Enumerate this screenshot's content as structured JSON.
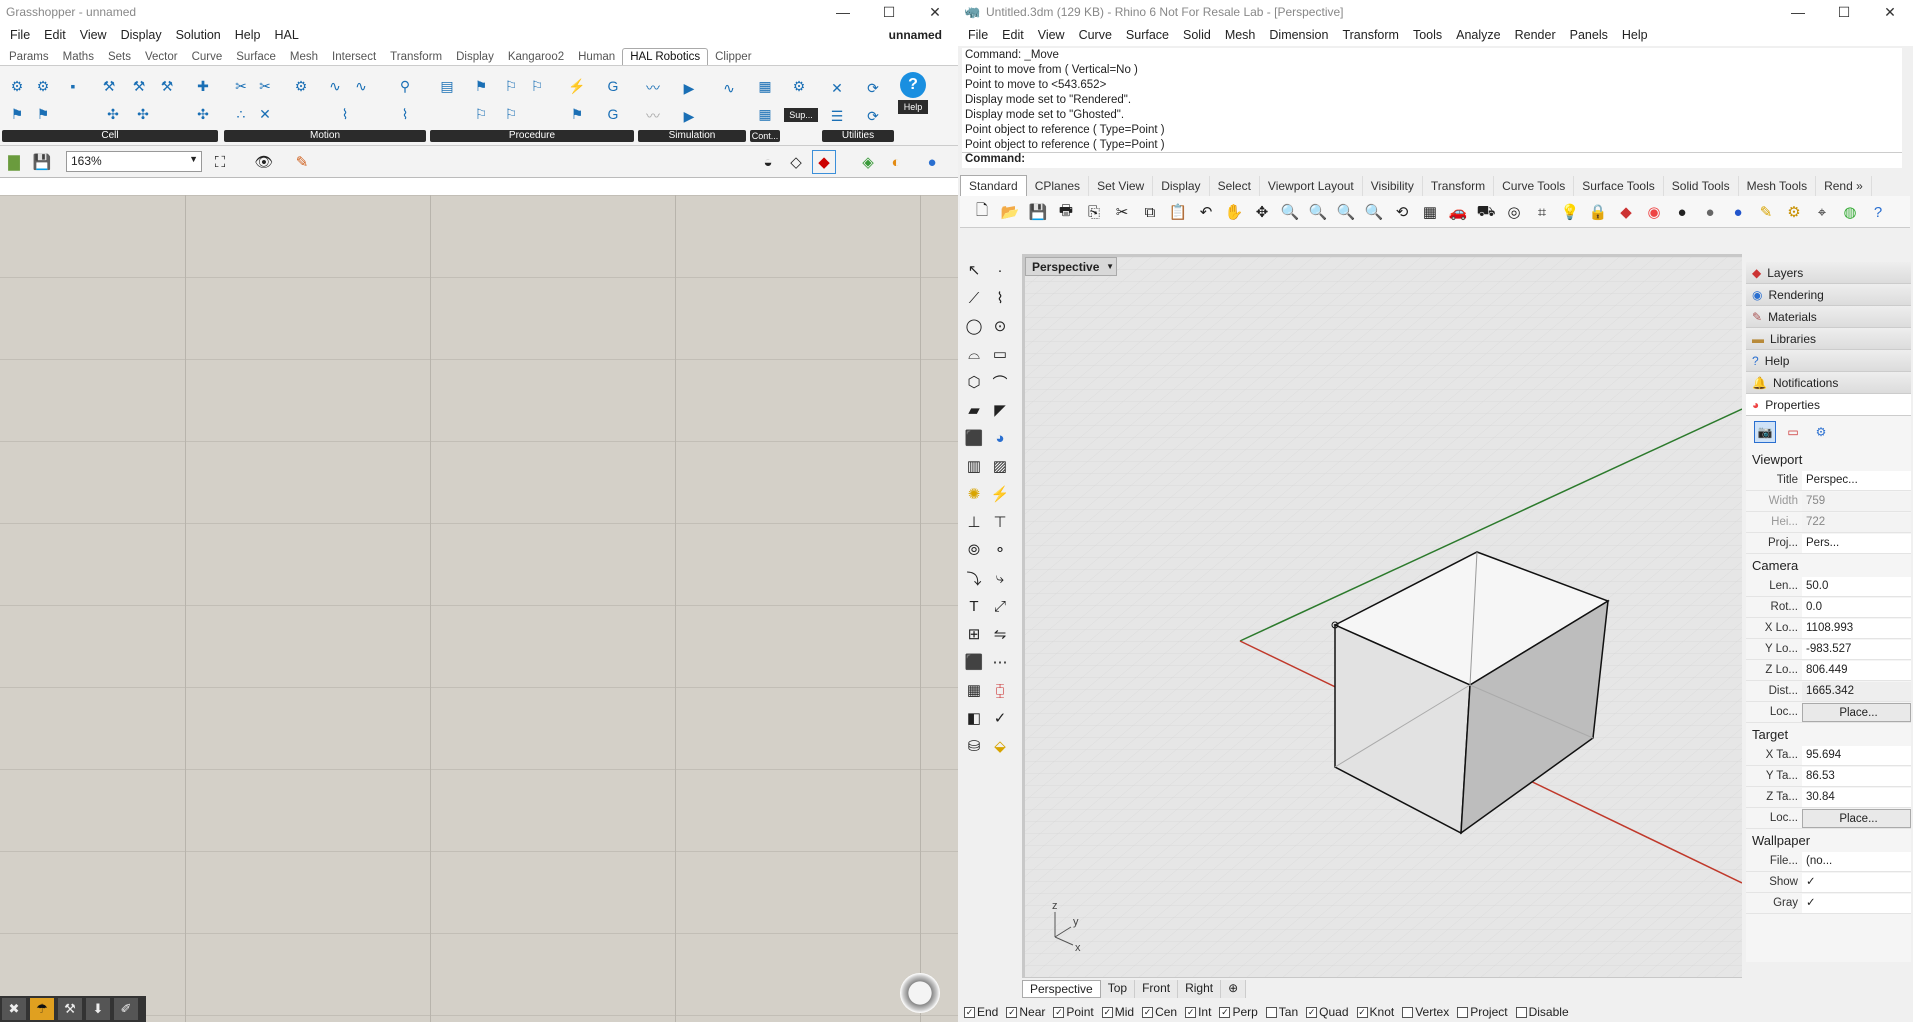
{
  "gh": {
    "title": "Grasshopper - unnamed",
    "doc_name": "unnamed",
    "menu": [
      "File",
      "Edit",
      "View",
      "Display",
      "Solution",
      "Help",
      "HAL"
    ],
    "tabs": [
      "Params",
      "Maths",
      "Sets",
      "Vector",
      "Curve",
      "Surface",
      "Mesh",
      "Intersect",
      "Transform",
      "Display",
      "Kangaroo2",
      "Human",
      "HAL Robotics",
      "Clipper"
    ],
    "active_tab": "HAL Robotics",
    "groups": [
      "Cell",
      "Motion",
      "Procedure",
      "Simulation",
      "Cont...",
      "Utilities"
    ],
    "sup_label": "Sup...",
    "help_label": "Help",
    "zoom": "163%",
    "canvas_color": "#d4d0c8"
  },
  "rhino": {
    "title": "Untitled.3dm (129 KB) - Rhino 6 Not For Resale Lab - [Perspective]",
    "menu": [
      "File",
      "Edit",
      "View",
      "Curve",
      "Surface",
      "Solid",
      "Mesh",
      "Dimension",
      "Transform",
      "Tools",
      "Analyze",
      "Render",
      "Panels",
      "Help"
    ],
    "command_history": [
      "Command: _Move",
      "Point to move from ( Vertical=No )",
      "Point to move to <543.652>",
      "Display mode set to \"Rendered\".",
      "Display mode set to \"Ghosted\".",
      "Point object to reference ( Type=Point )",
      "Point object to reference ( Type=Point )"
    ],
    "command_prompt": "Command:",
    "toolbar_tabs": [
      "Standard",
      "CPlanes",
      "Set View",
      "Display",
      "Select",
      "Viewport Layout",
      "Visibility",
      "Transform",
      "Curve Tools",
      "Surface Tools",
      "Solid Tools",
      "Mesh Tools",
      "Rend »"
    ],
    "active_toolbar_tab": "Standard",
    "viewport_name": "Perspective",
    "viewport_tabs": [
      "Perspective",
      "Top",
      "Front",
      "Right"
    ],
    "active_viewport_tab": "Perspective",
    "axis_labels": {
      "z": "z",
      "y": "y",
      "x": "x"
    },
    "osnaps": [
      {
        "label": "End",
        "checked": true
      },
      {
        "label": "Near",
        "checked": true
      },
      {
        "label": "Point",
        "checked": true
      },
      {
        "label": "Mid",
        "checked": true
      },
      {
        "label": "Cen",
        "checked": true
      },
      {
        "label": "Int",
        "checked": true
      },
      {
        "label": "Perp",
        "checked": true
      },
      {
        "label": "Tan",
        "checked": false
      },
      {
        "label": "Quad",
        "checked": true
      },
      {
        "label": "Knot",
        "checked": true
      },
      {
        "label": "Vertex",
        "checked": false
      },
      {
        "label": "Project",
        "checked": false
      },
      {
        "label": "Disable",
        "checked": false
      }
    ],
    "panel_tabs": [
      "Layers",
      "Rendering",
      "Materials",
      "Libraries",
      "Help",
      "Notifications",
      "Properties"
    ],
    "properties": {
      "viewport_header": "Viewport",
      "viewport_rows": [
        {
          "key": "Title",
          "value": "Perspec...",
          "disabled": false
        },
        {
          "key": "Width",
          "value": "759",
          "disabled": true
        },
        {
          "key": "Hei...",
          "value": "722",
          "disabled": true
        },
        {
          "key": "Proj...",
          "value": "Pers...",
          "disabled": false
        }
      ],
      "camera_header": "Camera",
      "camera_rows": [
        {
          "key": "Len...",
          "value": "50.0"
        },
        {
          "key": "Rot...",
          "value": "0.0"
        },
        {
          "key": "X Lo...",
          "value": "1108.993"
        },
        {
          "key": "Y Lo...",
          "value": "-983.527"
        },
        {
          "key": "Z Lo...",
          "value": "806.449"
        },
        {
          "key": "Dist...",
          "value": "1665.342"
        },
        {
          "key": "Loc...",
          "value": "Place..."
        }
      ],
      "target_header": "Target",
      "target_rows": [
        {
          "key": "X Ta...",
          "value": "95.694"
        },
        {
          "key": "Y Ta...",
          "value": "86.53"
        },
        {
          "key": "Z Ta...",
          "value": "30.84"
        },
        {
          "key": "Loc...",
          "value": "Place..."
        }
      ],
      "wallpaper_header": "Wallpaper",
      "wallpaper_rows": [
        {
          "key": "File...",
          "value": "(no..."
        },
        {
          "key": "Show",
          "value": "✓"
        },
        {
          "key": "Gray",
          "value": "✓"
        }
      ]
    }
  }
}
